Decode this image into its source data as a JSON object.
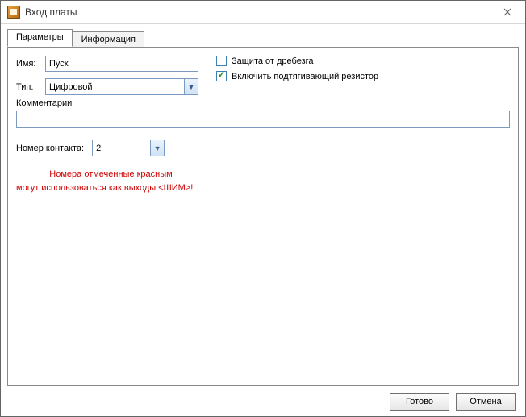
{
  "window": {
    "title": "Вход платы"
  },
  "tabs": {
    "params": "Параметры",
    "info": "Информация"
  },
  "labels": {
    "name": "Имя:",
    "type": "Тип:",
    "comments": "Комментарии",
    "contact": "Номер контакта:"
  },
  "fields": {
    "name_value": "Пуск",
    "type_value": "Цифровой",
    "comment_value": "",
    "contact_value": "2"
  },
  "checks": {
    "debounce": {
      "label": "Защита от дребезга",
      "checked": false
    },
    "pullup": {
      "label": "Включить подтягивающий резистор",
      "checked": true
    }
  },
  "warn": {
    "line1": "Номера отмеченные красным",
    "line2": "могут использоваться как выходы <ШИМ>!"
  },
  "buttons": {
    "ok": "Готово",
    "cancel": "Отмена"
  }
}
